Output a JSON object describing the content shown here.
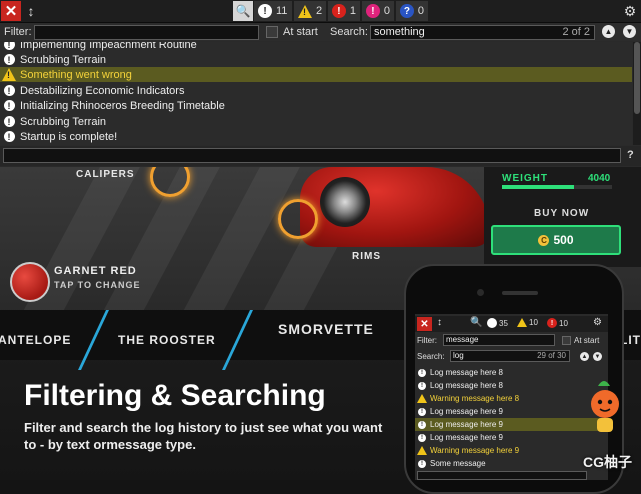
{
  "console": {
    "toolbar": {
      "counts": {
        "log": "11",
        "warning": "2",
        "error": "1",
        "exception": "0",
        "assert": "0"
      },
      "badges": {
        "error_glyph": "!",
        "exception_glyph": "!",
        "assert_glyph": "?",
        "log_glyph": "!",
        "warning_glyph": "!"
      }
    },
    "filter": {
      "label": "Filter:",
      "value": ""
    },
    "at_start": {
      "label": "At start"
    },
    "search": {
      "label": "Search:",
      "value": "something",
      "match": "2 of 2"
    },
    "help": "?",
    "log_rows": [
      {
        "type": "log",
        "text": "Implementing Impeachment Routine"
      },
      {
        "type": "log",
        "text": "Scrubbing Terrain"
      },
      {
        "type": "warning",
        "text": "Something went wrong",
        "selected": true
      },
      {
        "type": "log",
        "text": "Destabilizing Economic Indicators"
      },
      {
        "type": "log",
        "text": "Initializing Rhinoceros Breeding Timetable"
      },
      {
        "type": "log",
        "text": "Scrubbing Terrain"
      },
      {
        "type": "log",
        "text": "Startup is complete!"
      }
    ]
  },
  "scene": {
    "labels": {
      "calipers": "CALIPERS",
      "rims": "RIMS"
    },
    "weight": {
      "label": "WEIGHT",
      "value": "4040",
      "fill": 0.65
    },
    "buy": {
      "label": "BUY NOW",
      "price": "500",
      "coin_glyph": "C"
    },
    "color": {
      "name": "GARNET RED",
      "action": "TAP TO CHANGE"
    },
    "cars": [
      "ANTELOPE",
      "THE ROOSTER",
      "SMORVETTE",
      "LITT"
    ],
    "heading": "Filtering & Searching",
    "subtext": "Filter and search the log history to just see what you want to - by text ormessage type."
  },
  "phone": {
    "counts": {
      "log": "35",
      "warning": "10",
      "error": "10"
    },
    "filter": {
      "label": "Filter:",
      "value": "message"
    },
    "at_start": {
      "label": "At start"
    },
    "search": {
      "label": "Search:",
      "value": "log",
      "match": "29 of 30"
    },
    "log_rows": [
      {
        "type": "log",
        "text": "Log message here 8"
      },
      {
        "type": "log",
        "text": "Log message here 8"
      },
      {
        "type": "warning",
        "text": "Warning message here 8"
      },
      {
        "type": "log",
        "text": "Log message here 9"
      },
      {
        "type": "log",
        "text": "Log message here 9",
        "selected": true
      },
      {
        "type": "log",
        "text": "Log message here 9"
      },
      {
        "type": "warning",
        "text": "Warning message here 9"
      },
      {
        "type": "log",
        "text": "Some message"
      }
    ]
  },
  "watermark": {
    "text": "CG柚子"
  },
  "colors": {
    "close_red": "#c8261f",
    "selected_row_bg": "#5b5b20",
    "selected_row_text": "#f4d23a",
    "accent_green": "#2ee07a",
    "accent_blue": "#2aa7d9"
  }
}
